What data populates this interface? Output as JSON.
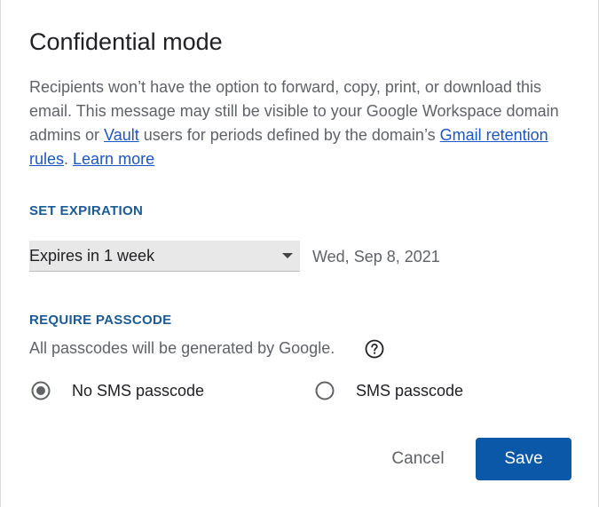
{
  "dialog": {
    "title": "Confidential mode",
    "description": {
      "part1": "Recipients won’t have the option to forward, copy, print, or download this email. This message may still be visible to your Google Workspace domain admins or ",
      "vault_link": "Vault",
      "part2": " users for periods defined by the domain’s ",
      "retention_link": "Gmail retention rules",
      "part3": ". ",
      "learn_more_link": "Learn more"
    }
  },
  "expiration": {
    "label": "SET EXPIRATION",
    "selected": "Expires in 1 week",
    "date": "Wed, Sep 8, 2021"
  },
  "passcode": {
    "label": "REQUIRE PASSCODE",
    "note": "All passcodes will be generated by Google.",
    "options": [
      {
        "label": "No SMS passcode",
        "selected": true
      },
      {
        "label": "SMS passcode",
        "selected": false
      }
    ]
  },
  "actions": {
    "cancel_label": "Cancel",
    "save_label": "Save"
  },
  "colors": {
    "accent": "#0b57a8",
    "link": "#1a57c6",
    "section_label": "#1a5a98"
  },
  "icons": {
    "help": "help-circle-icon",
    "dropdown": "caret-down-icon"
  }
}
